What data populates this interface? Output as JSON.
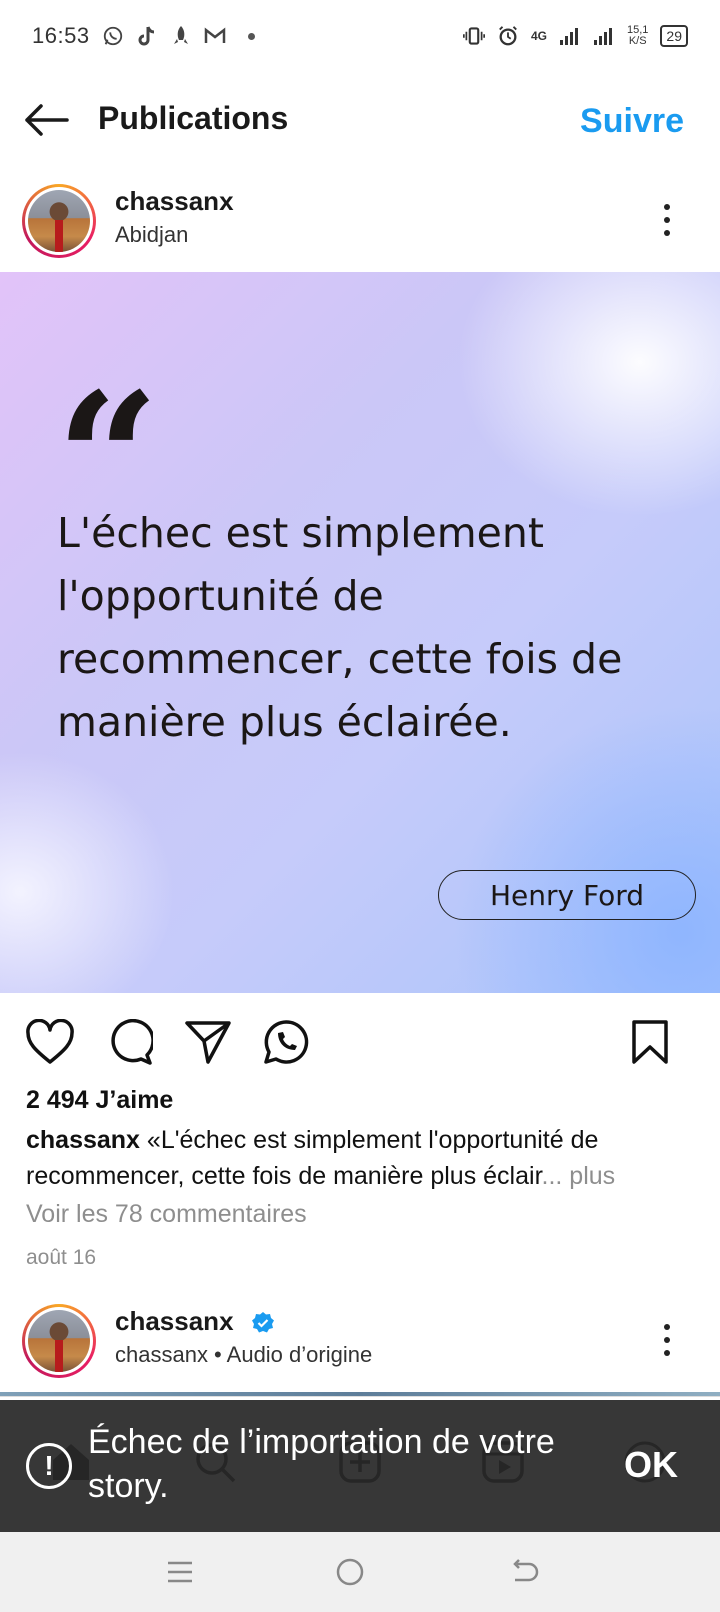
{
  "status_bar": {
    "time": "16:53",
    "network": "4G",
    "speed_value": "15,1",
    "speed_unit": "K/S",
    "battery": "29",
    "notification_icons": [
      "whatsapp-icon",
      "tiktok-icon",
      "rocket-icon",
      "gmail-icon"
    ]
  },
  "header": {
    "title": "Publications",
    "follow_label": "Suivre"
  },
  "post": {
    "username": "chassanx",
    "location": "Abidjan",
    "image": {
      "quote_mark": "“",
      "quote_text": "L'échec est simplement l'opportunité de recommencer, cette fois de manière plus éclairée.",
      "author": "Henry Ford"
    },
    "likes": "2 494 J’aime",
    "caption_user": "chassanx",
    "caption_text": "«L'échec est simplement l'opportunité de recommencer, cette fois de manière plus éclair",
    "caption_more": "... plus",
    "comments_link": "Voir les 78 commentaires",
    "date": "août 16"
  },
  "next_post": {
    "username": "chassanx",
    "subtitle": "chassanx • Audio d’origine"
  },
  "toast": {
    "message": "Échec de l’importation de votre story.",
    "ok_label": "OK",
    "icon": "!"
  },
  "colors": {
    "accent": "#1a9bf0",
    "toast_bg": "#282828"
  }
}
